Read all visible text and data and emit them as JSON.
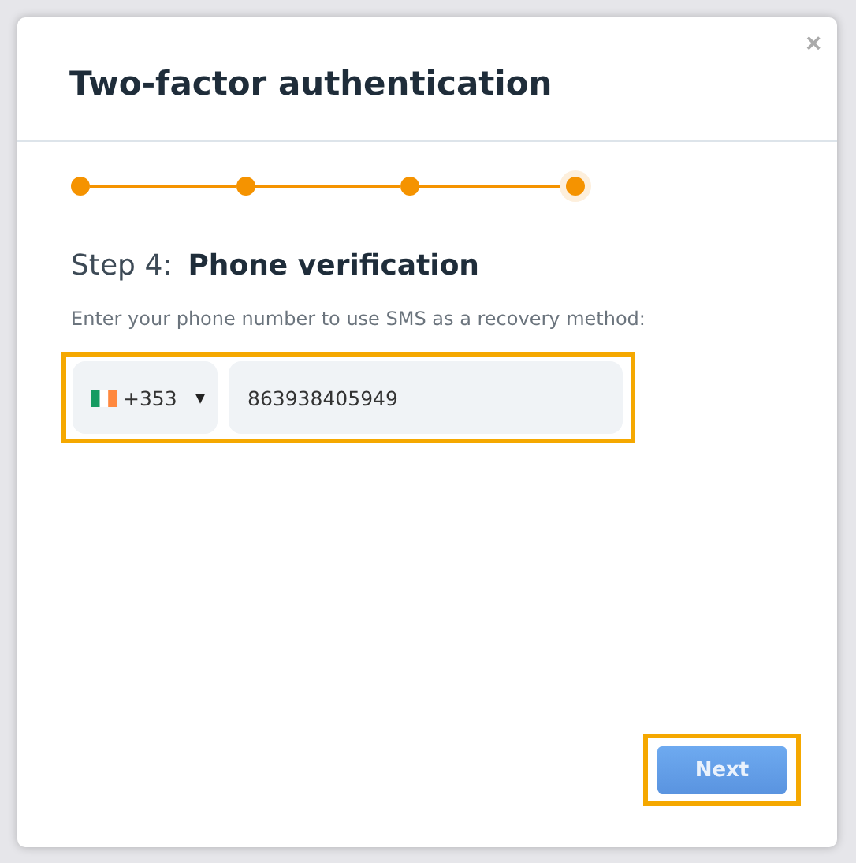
{
  "dialog": {
    "title": "Two-factor authentication",
    "close": "×"
  },
  "steps": [
    {
      "selected": false
    },
    {
      "selected": false
    },
    {
      "selected": false
    },
    {
      "selected": true
    }
  ],
  "step_label": "Step 4:",
  "step_title": "Phone verification",
  "instruction": "Enter your phone number to use SMS as a recovery method:",
  "phone": {
    "country_code": "+353",
    "caret": "▾",
    "value": "863938405949",
    "highlighted": true
  },
  "next_button": {
    "label": "Next",
    "highlighted": true
  }
}
